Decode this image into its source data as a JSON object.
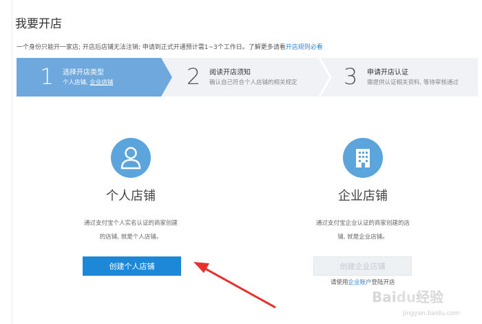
{
  "page": {
    "title": "我要开店",
    "notice": "一个身份只能开一家店; 开店后店铺无法注销; 申请到正式开通预计需1~3个工作日。了解更多请看",
    "notice_link": "开店规则必看"
  },
  "steps": [
    {
      "num": "1",
      "title": "选择开店类型",
      "desc_a": "个人店铺,",
      "desc_b": "企业店铺",
      "active": true
    },
    {
      "num": "2",
      "title": "阅读开店须知",
      "desc": "确认自己符合个人店铺的相关规定",
      "active": false
    },
    {
      "num": "3",
      "title": "申请开店认证",
      "desc": "需提供认证相关资料, 等待审核通过",
      "active": false
    }
  ],
  "personal": {
    "icon": "person-icon",
    "title": "个人店铺",
    "desc1": "通过支付宝个人实名认证的商家创建",
    "desc2": "的店铺, 就是个人店铺。",
    "button": "创建个人店铺"
  },
  "enterprise": {
    "icon": "building-icon",
    "title": "企业店铺",
    "desc1": "通过支付宝企业认证的商家创建的店",
    "desc2": "铺, 就是企业店铺。",
    "button": "创建企业店铺",
    "hint_pre": "请使用",
    "hint_link": "企业账户",
    "hint_post": "登陆开店"
  },
  "watermark": "Baidu经验 jingyan.baidu.com",
  "colors": {
    "accent": "#1e88d8",
    "step_active": "#6fa8dc",
    "annotation_arrow": "#e8312d"
  }
}
